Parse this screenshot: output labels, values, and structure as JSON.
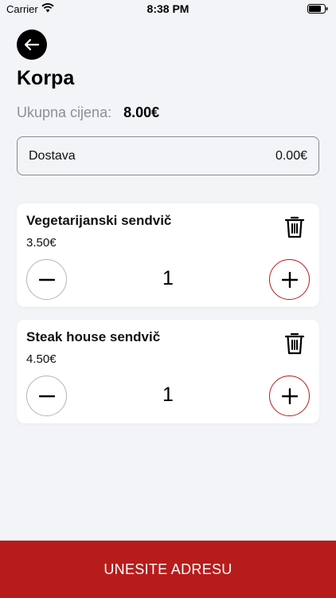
{
  "status_bar": {
    "carrier": "Carrier",
    "time": "8:38 PM"
  },
  "header": {
    "title": "Korpa"
  },
  "summary": {
    "total_label": "Ukupna cijena:",
    "total_value": "8.00€"
  },
  "delivery": {
    "label": "Dostava",
    "value": "0.00€"
  },
  "cart": {
    "items": [
      {
        "name": "Vegetarijanski sendvič",
        "price": "3.50€",
        "quantity": "1"
      },
      {
        "name": "Steak house sendvič",
        "price": "4.50€",
        "quantity": "1"
      }
    ]
  },
  "footer": {
    "submit_label": "UNESITE ADRESU"
  },
  "colors": {
    "accent": "#b71c1c",
    "background": "#f3f4f8",
    "card": "#ffffff"
  }
}
